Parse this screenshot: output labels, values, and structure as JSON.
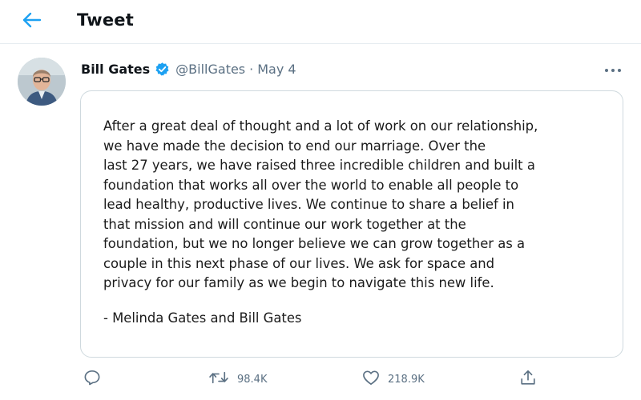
{
  "header": {
    "title": "Tweet",
    "back_icon": "arrow-left-icon",
    "accent_color": "#1da1f2"
  },
  "tweet": {
    "author_name": "Bill Gates",
    "verified_icon": "verified-badge-icon",
    "handle": "@BillGates",
    "separator": "·",
    "date": "May 4",
    "more_icon": "more-dots-icon",
    "statement_lines": [
      "After a great deal of thought and a lot of work on our relationship,",
      "we have made the decision to end our marriage. Over the",
      "last 27 years, we have raised three incredible children and built a",
      "foundation that works all over the world to enable all people to",
      "lead healthy, productive lives. We continue to share a belief in",
      "that mission and will continue our work together at the",
      "foundation, but we no longer believe we can grow together as a",
      "couple in this next phase of our lives. We ask for space and",
      "privacy for our family as we begin to navigate this new life."
    ],
    "signature": "- Melinda Gates and Bill Gates"
  },
  "actions": {
    "reply_icon": "reply-icon",
    "retweet_icon": "retweet-icon",
    "retweet_count": "98.4K",
    "like_icon": "heart-icon",
    "like_count": "218.9K",
    "share_icon": "share-icon"
  }
}
